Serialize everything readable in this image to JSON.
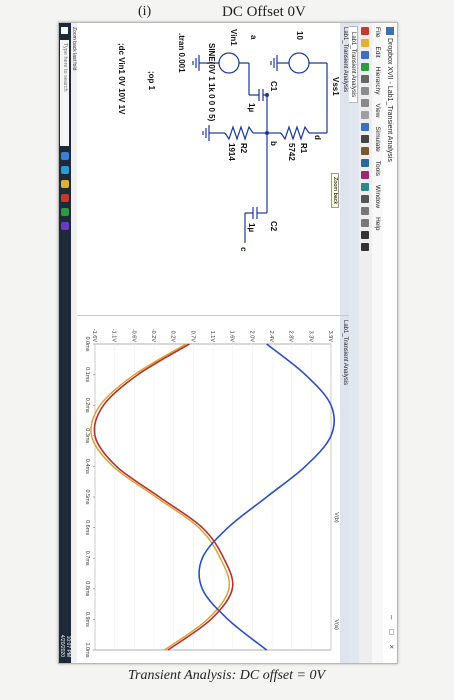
{
  "page": {
    "roman": "(i)",
    "title": "DC Offset 0V",
    "caption": "Transient Analysis: DC offset = 0V"
  },
  "window": {
    "title": "Dropbox XVII - Lab1_Transient Analysis",
    "menus": [
      "File",
      "Edit",
      "Hierarchy",
      "View",
      "Simulate",
      "Tools",
      "Window",
      "Help"
    ],
    "tab_label": "Lab1_Transient Analysis",
    "zoom_tip": "Zoom back",
    "plot_tab": "Lab1_Transient Analysis",
    "status": "Zoom back last fold"
  },
  "schematic": {
    "source_vss": "Vss1",
    "vss_value": "10",
    "node_d": "d",
    "r1": "R1",
    "r1_value": "5742",
    "node_a": "a",
    "c1": "C1",
    "c1_value": "1µ",
    "node_b": "b",
    "c2": "C2",
    "c2_value": "1µ",
    "node_c": "c",
    "vin": "Vin1",
    "r2": "R2",
    "r2_value": "1914",
    "sine": "SINE(0V 1 1k 0 0 0 5)",
    "tran": ".tran 0.001",
    "op": ";op 1",
    "dc": ";dc Vin1 0V 10V 1V"
  },
  "plot": {
    "trace_labels": [
      "V(b)",
      "V(a)"
    ],
    "colors": {
      "blue": "#2a4fc4",
      "red": "#b8322a",
      "orange": "#d9a030"
    }
  },
  "chart_data": {
    "type": "line",
    "x": [
      0,
      0.1,
      0.2,
      0.3,
      0.4,
      0.5,
      0.6,
      0.7,
      0.8,
      0.9,
      1.0
    ],
    "series": [
      {
        "name": "V(b)",
        "color": "#2a4fc4",
        "values": [
          2.4,
          3.3,
          3.9,
          3.9,
          3.3,
          2.4,
          1.5,
          0.9,
          0.9,
          1.5,
          2.4
        ]
      },
      {
        "name": "V(a)",
        "color": "#b8322a",
        "values": [
          0.6,
          -0.6,
          -1.4,
          -1.6,
          -1.1,
          -0.1,
          0.9,
          1.4,
          1.6,
          1.1,
          0.1
        ]
      }
    ],
    "xlabel": "",
    "ylabel": "",
    "xlim": [
      0,
      1.0
    ],
    "ylim": [
      -1.6,
      3.9
    ],
    "x_ticks": [
      "0.0ms",
      "0.1ms",
      "0.2ms",
      "0.3ms",
      "0.4ms",
      "0.5ms",
      "0.6ms",
      "0.7ms",
      "0.8ms",
      "0.9ms",
      "1.0ms"
    ],
    "y_ticks": [
      "3.9V",
      "3.3V",
      "2.8V",
      "2.4V",
      "2.0V",
      "1.6V",
      "1.1V",
      "0.7V",
      "0.2V",
      "-0.2V",
      "-0.6V",
      "-1.1V",
      "-1.6V"
    ]
  },
  "taskbar": {
    "search_placeholder": "Type here to search",
    "time": "10:07 PM",
    "date": "4/20/2020"
  }
}
